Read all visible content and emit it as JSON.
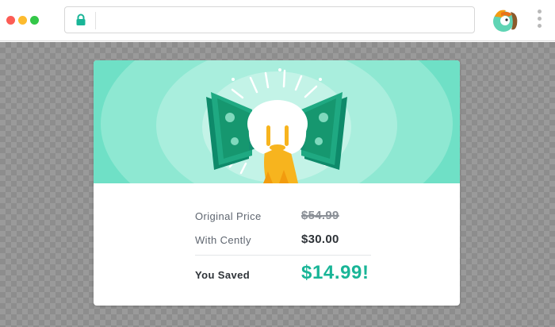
{
  "browser": {
    "url": ""
  },
  "savings": {
    "original_label": "Original Price",
    "original_value": "$54.99",
    "centy_label": "With Cently",
    "centy_value": "$30.00",
    "saved_label": "You Saved",
    "saved_value": "$14.99!"
  },
  "colors": {
    "accent": "#19b597",
    "hero_bg": "#6fe0c6",
    "money_green": "#1fa982",
    "tail_orange": "#f7b41e"
  },
  "icons": {
    "lock": "lock-icon",
    "extension": "cently-extension-icon",
    "menu": "kebab-menu-icon",
    "hero": "money-bowtie-mascot-illustration"
  }
}
